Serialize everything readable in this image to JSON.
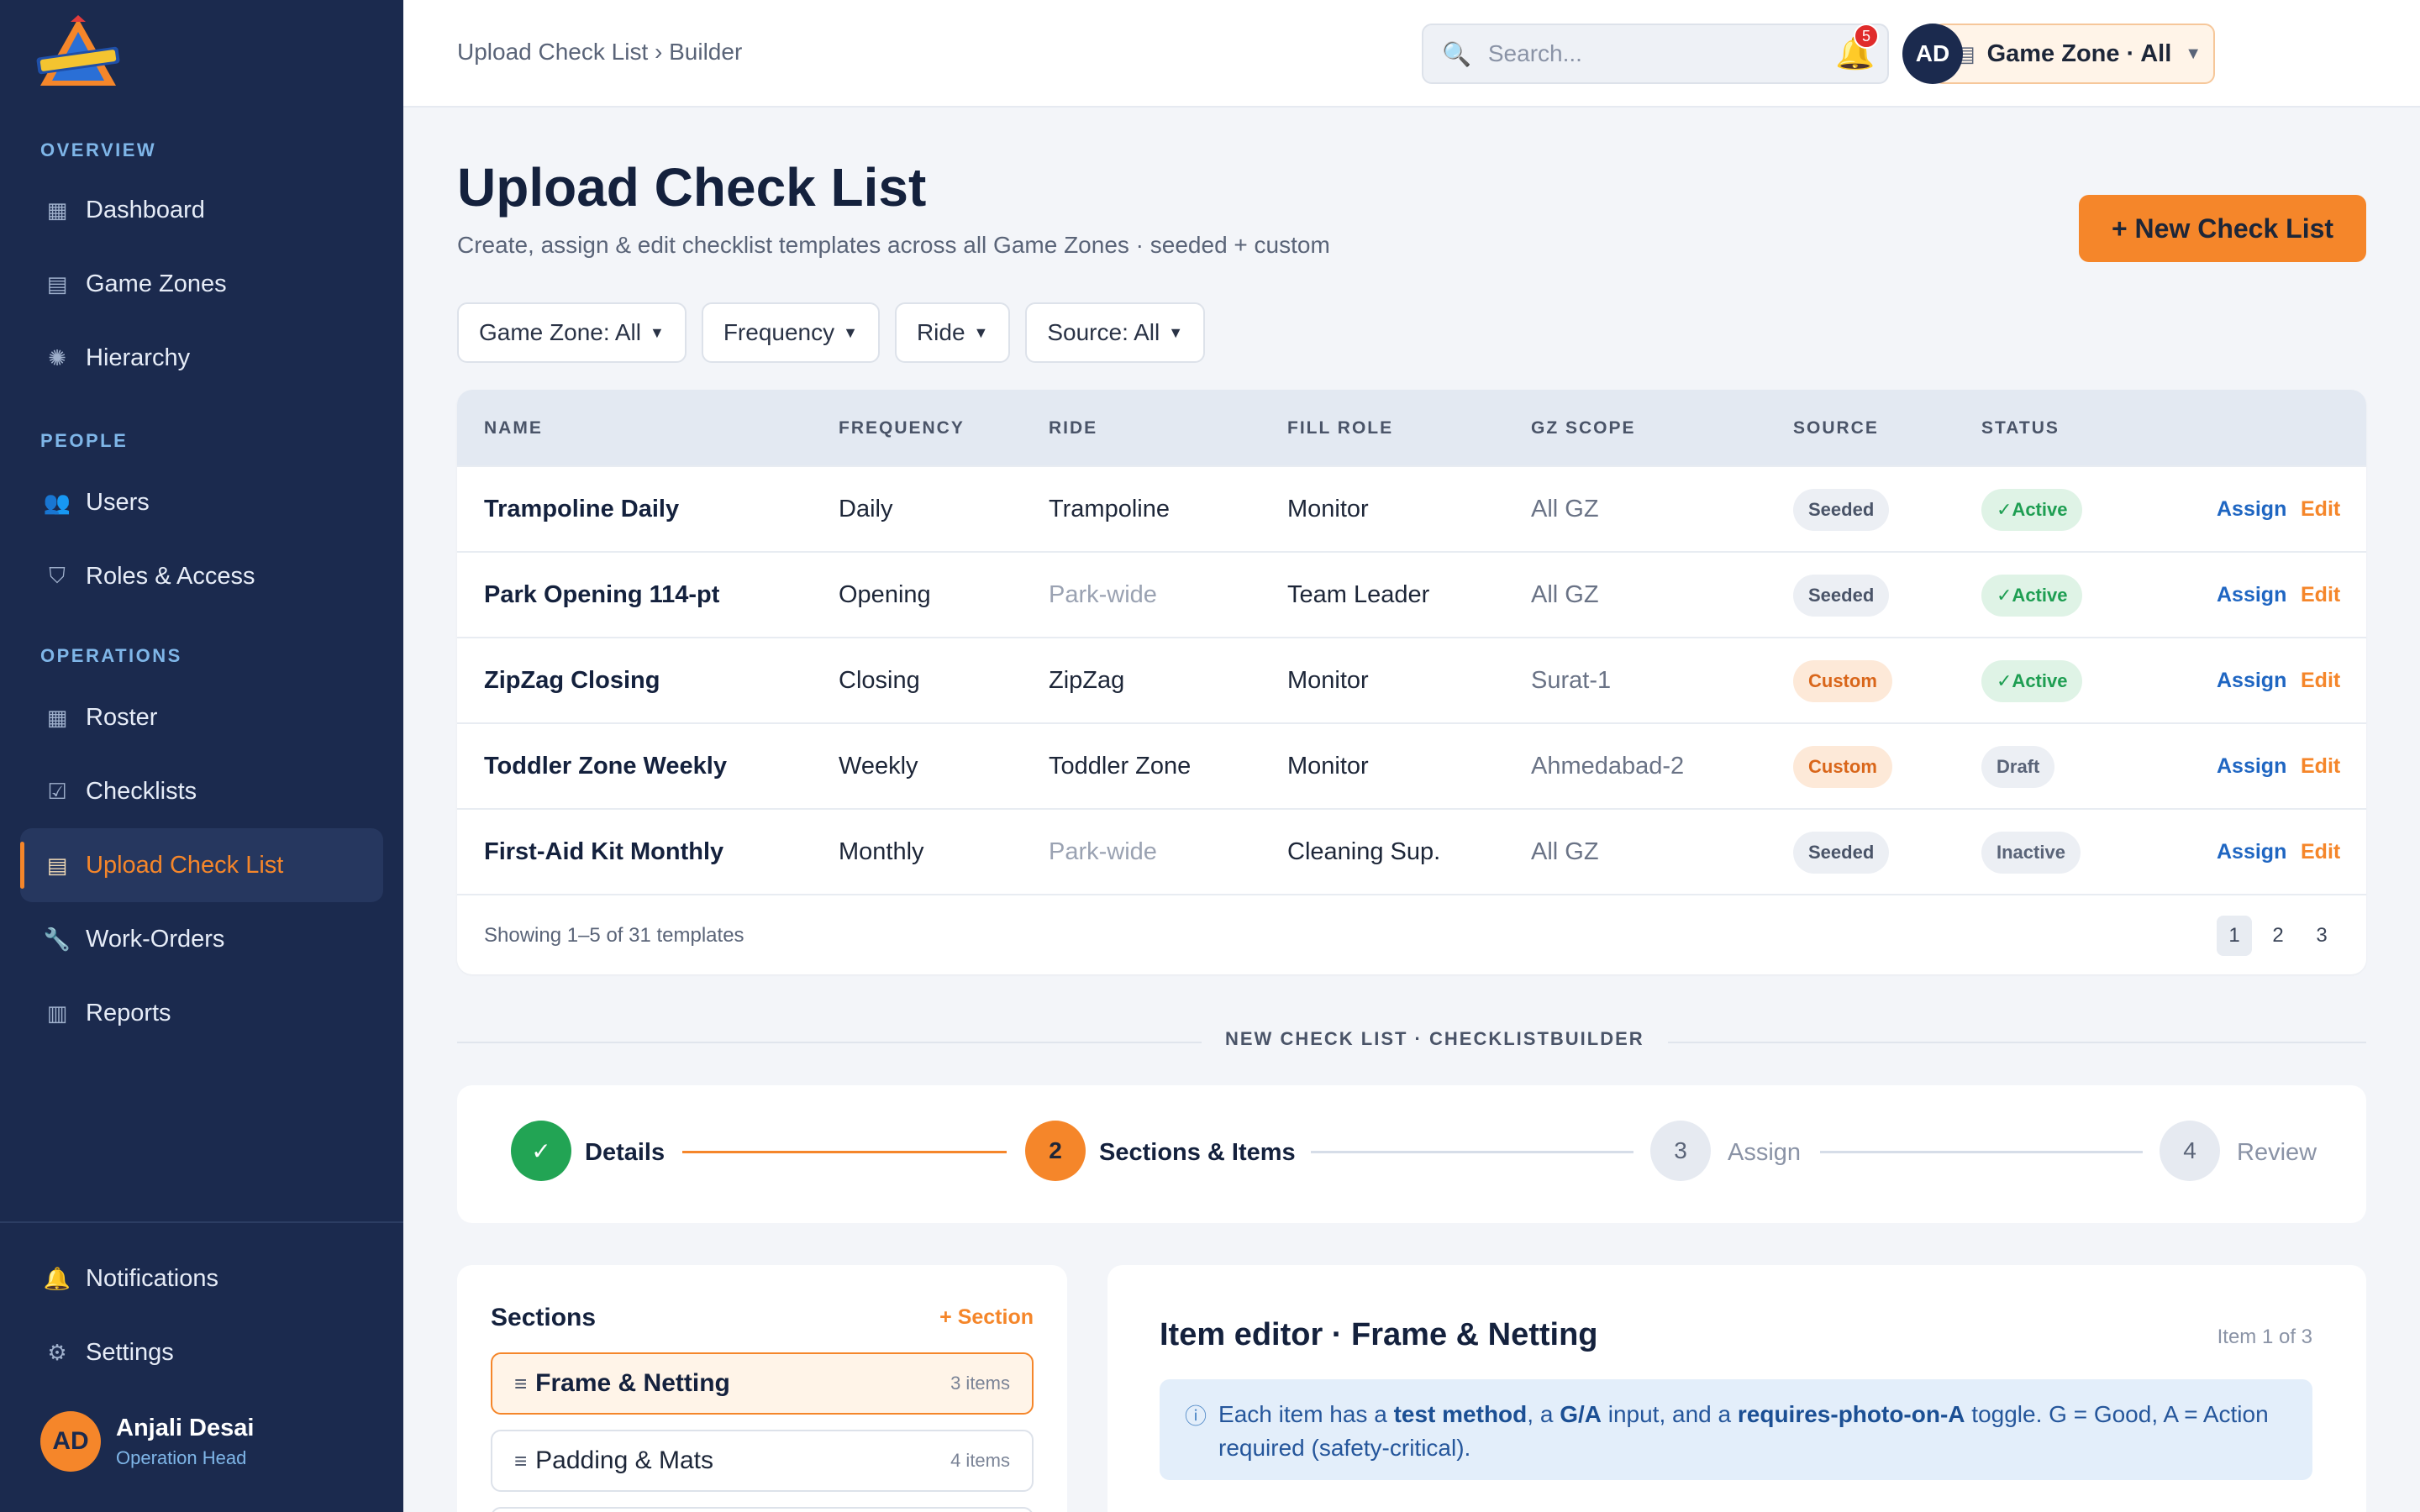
{
  "sidebar": {
    "sections": {
      "overview": "OVERVIEW",
      "people": "PEOPLE",
      "operations": "OPERATIONS"
    },
    "items": [
      {
        "label": "Dashboard",
        "icon": "dashboard-icon"
      },
      {
        "label": "Game Zones",
        "icon": "building-icon"
      },
      {
        "label": "Hierarchy",
        "icon": "hierarchy-icon"
      },
      {
        "label": "Users",
        "icon": "users-icon"
      },
      {
        "label": "Roles & Access",
        "icon": "shield-icon"
      },
      {
        "label": "Roster",
        "icon": "calendar-icon"
      },
      {
        "label": "Checklists",
        "icon": "checkbox-icon"
      },
      {
        "label": "Upload Check List",
        "icon": "clipboard-icon",
        "active": true
      },
      {
        "label": "Work-Orders",
        "icon": "wrench-icon"
      },
      {
        "label": "Reports",
        "icon": "chart-icon"
      }
    ],
    "bottom": [
      {
        "label": "Notifications",
        "icon": "bell-icon"
      },
      {
        "label": "Settings",
        "icon": "gear-icon"
      }
    ],
    "user": {
      "initials": "AD",
      "name": "Anjali Desai",
      "role": "Operation Head"
    }
  },
  "topbar": {
    "breadcrumb": "Upload Check List › Builder",
    "search_placeholder": "Search...",
    "zone_select": "Game Zone · All",
    "notification_count": "5",
    "avatar_initials": "AD"
  },
  "page": {
    "title": "Upload Check List",
    "subtitle": "Create, assign & edit checklist templates across all Game Zones · seeded + custom",
    "new_button": "+ New Check List"
  },
  "filters": [
    "Game Zone: All",
    "Frequency",
    "Ride",
    "Source: All"
  ],
  "table": {
    "columns": [
      "NAME",
      "FREQUENCY",
      "RIDE",
      "FILL ROLE",
      "GZ SCOPE",
      "SOURCE",
      "STATUS"
    ],
    "rows": [
      {
        "name": "Trampoline Daily",
        "frequency": "Daily",
        "ride": "Trampoline",
        "role": "Monitor",
        "scope": "All GZ",
        "source": "Seeded",
        "status": "✓Active",
        "assign": "Assign",
        "edit": "Edit"
      },
      {
        "name": "Park Opening 114-pt",
        "frequency": "Opening",
        "ride": "Park-wide",
        "role": "Team Leader",
        "scope": "All GZ",
        "source": "Seeded",
        "status": "✓Active",
        "assign": "Assign",
        "edit": "Edit"
      },
      {
        "name": "ZipZag Closing",
        "frequency": "Closing",
        "ride": "ZipZag",
        "role": "Monitor",
        "scope": "Surat-1",
        "source": "Custom",
        "status": "✓Active",
        "assign": "Assign",
        "edit": "Edit"
      },
      {
        "name": "Toddler Zone Weekly",
        "frequency": "Weekly",
        "ride": "Toddler Zone",
        "role": "Monitor",
        "scope": "Ahmedabad-2",
        "source": "Custom",
        "status": "Draft",
        "assign": "Assign",
        "edit": "Edit"
      },
      {
        "name": "First-Aid Kit Monthly",
        "frequency": "Monthly",
        "ride": "Park-wide",
        "role": "Cleaning Sup.",
        "scope": "All GZ",
        "source": "Seeded",
        "status": "Inactive",
        "assign": "Assign",
        "edit": "Edit"
      }
    ],
    "footer": "Showing 1–5 of 31 templates",
    "pages": [
      "1",
      "2",
      "3"
    ]
  },
  "builder": {
    "label": "NEW CHECK LIST · CHECKLISTBUILDER",
    "steps": [
      {
        "number": "✓",
        "label": "Details"
      },
      {
        "number": "2",
        "label": "Sections & Items"
      },
      {
        "number": "3",
        "label": "Assign"
      },
      {
        "number": "4",
        "label": "Review"
      }
    ],
    "sections": {
      "title": "Sections",
      "add": "+ Section",
      "items": [
        {
          "label": "Frame & Netting",
          "count": "3 items"
        },
        {
          "label": "Padding & Mats",
          "count": "4 items"
        }
      ]
    },
    "editor": {
      "title": "Item editor · Frame & Netting",
      "count": "Item 1 of 3",
      "info_1": "Each item has a ",
      "info_b1": "test method",
      "info_2": ", a ",
      "info_b2": "G/A",
      "info_3": " input, and a ",
      "info_b3": "requires-photo-on-A",
      "info_4": " toggle. G = Good, A = Action required (safety-critical)."
    }
  }
}
